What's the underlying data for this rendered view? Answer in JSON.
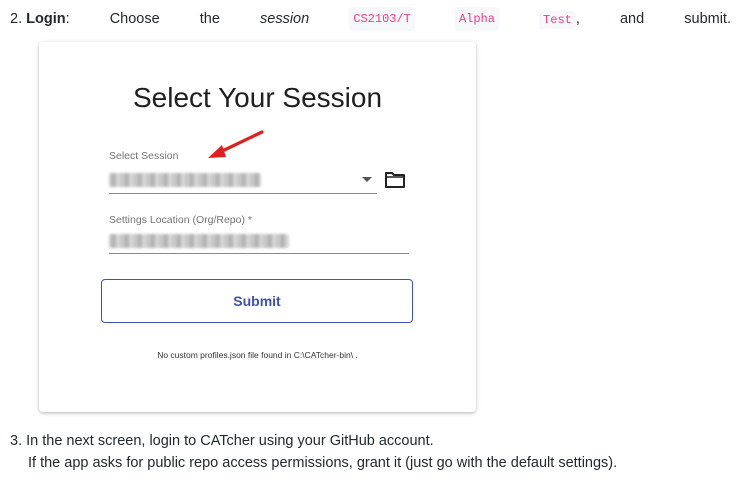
{
  "step2": {
    "number": "2.",
    "bold_label": "Login",
    "colon": ":",
    "words": [
      "Choose",
      "the"
    ],
    "em_word": "session",
    "code": [
      "CS2103/T",
      "Alpha",
      "Test"
    ],
    "comma": ",",
    "tail": [
      "and",
      "submit."
    ]
  },
  "card": {
    "title": "Select Your Session",
    "session_label": "Select Session",
    "settings_label": "Settings Location (Org/Repo) *",
    "submit_label": "Submit",
    "note": "No custom profiles.json file found in C:\\CATcher-bin\\ ."
  },
  "step3": {
    "line1": "3. In the next screen, login to CATcher using your GitHub account.",
    "line2": "If the app asks for public repo access permissions, grant it (just go with the default settings)."
  },
  "icons": {
    "dropdown": "caret-down-icon",
    "folder": "folder-icon",
    "annotation": "red-arrow-icon"
  },
  "colors": {
    "accent": "#3f51b5",
    "code_text": "#e83e8c",
    "annotation_arrow": "#e02020"
  }
}
